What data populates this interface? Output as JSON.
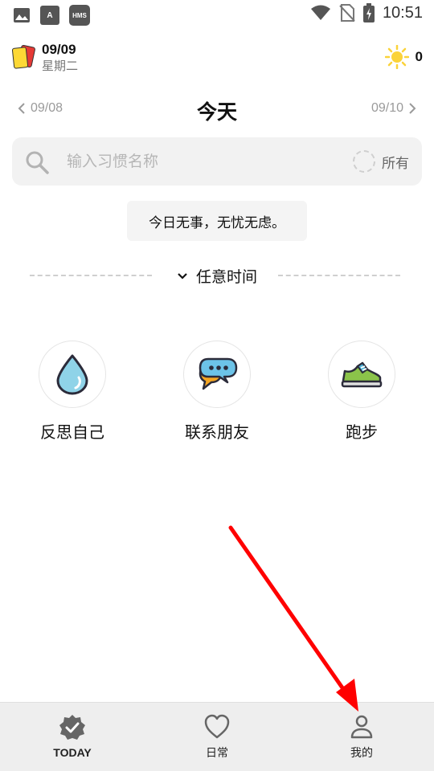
{
  "status_bar": {
    "left_icons": [
      "image-icon",
      "a-font-icon",
      "hms-icon"
    ],
    "hms_label": "HMS",
    "a_label": "A",
    "time": "10:51",
    "right_icons": [
      "wifi-icon",
      "no-sim-icon",
      "battery-charging-icon"
    ]
  },
  "header": {
    "date": "09/09",
    "weekday": "星期二",
    "sun_count": "0"
  },
  "day_nav": {
    "prev": "09/08",
    "title": "今天",
    "next": "09/10"
  },
  "search": {
    "placeholder": "输入习惯名称",
    "value": "",
    "filter_label": "所有"
  },
  "quote": "今日无事，无忧无虑。",
  "section": {
    "label": "任意时间"
  },
  "habits": [
    {
      "label": "反思自己",
      "icon": "water-drop-icon"
    },
    {
      "label": "联系朋友",
      "icon": "chat-bubbles-icon"
    },
    {
      "label": "跑步",
      "icon": "sneaker-icon"
    }
  ],
  "bottom_nav": {
    "items": [
      {
        "label": "TODAY",
        "icon": "badge-check-icon",
        "active": true
      },
      {
        "label": "日常",
        "icon": "heart-icon",
        "active": false
      },
      {
        "label": "我的",
        "icon": "person-icon",
        "active": false
      }
    ]
  },
  "colors": {
    "annotation_arrow": "#ff0000",
    "nav_background": "#eeeeee",
    "search_background": "#f2f2f2"
  }
}
